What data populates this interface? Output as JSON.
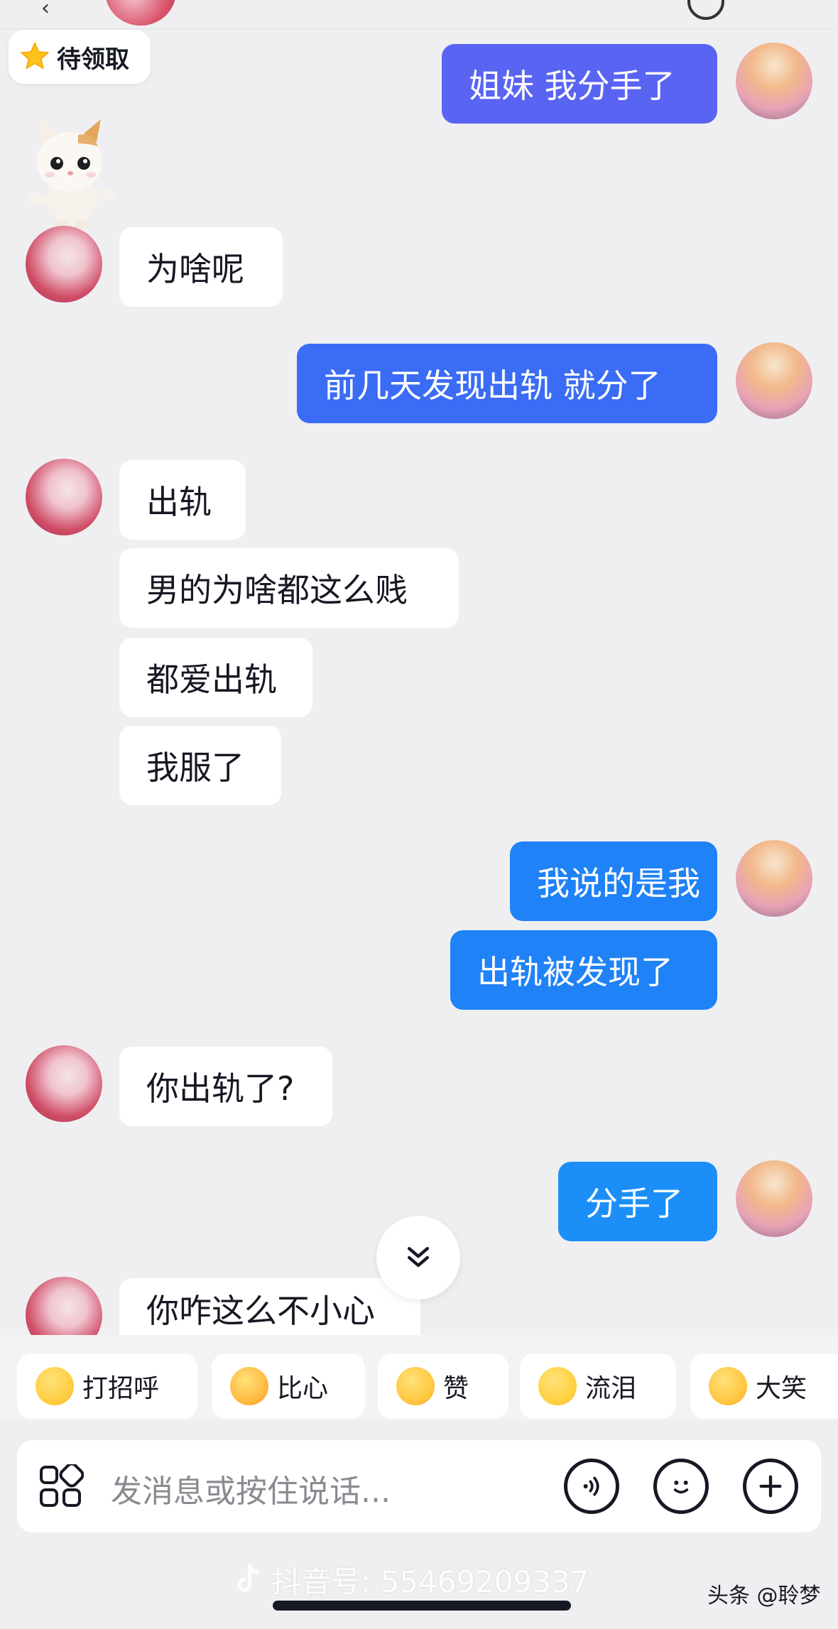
{
  "claim_badge": {
    "label": "待领取",
    "icon": "star-icon"
  },
  "conversation": [
    {
      "side": "right",
      "text": "姐妹 我分手了",
      "color": "#5a64f2",
      "group_start": true
    },
    {
      "side": "left",
      "text": "为啥呢",
      "group_start": true
    },
    {
      "side": "right",
      "text": "前几天发现出轨 就分了",
      "color": "#3a6cf5",
      "group_start": true
    },
    {
      "side": "left",
      "text": "出轨",
      "group_start": true
    },
    {
      "side": "left",
      "text": "男的为啥都这么贱",
      "group_start": false
    },
    {
      "side": "left",
      "text": "都爱出轨",
      "group_start": false
    },
    {
      "side": "left",
      "text": "我服了",
      "group_start": false
    },
    {
      "side": "right",
      "text": "我说的是我",
      "color": "#1f82f6",
      "group_start": true
    },
    {
      "side": "right",
      "text": "出轨被发现了",
      "color": "#1f82f6",
      "group_start": false
    },
    {
      "side": "left",
      "text": "你出轨了?",
      "group_start": true
    },
    {
      "side": "right",
      "text": "分手了",
      "color": "#1b8ff7",
      "group_start": true
    },
    {
      "side": "left",
      "text": "你咋这么不小心",
      "group_start": true
    }
  ],
  "quick_replies": [
    {
      "label": "打招呼",
      "icon": "wave-emoji-icon"
    },
    {
      "label": "比心",
      "icon": "finger-heart-emoji-icon"
    },
    {
      "label": "赞",
      "icon": "thumbs-up-emoji-icon"
    },
    {
      "label": "流泪",
      "icon": "crying-emoji-icon"
    },
    {
      "label": "大笑",
      "icon": "laughing-emoji-icon"
    }
  ],
  "input": {
    "placeholder": "发消息或按住说话..."
  },
  "watermark": {
    "text": "抖音号: 55469209337"
  },
  "corner_mark": {
    "text": "头条 @聆梦"
  },
  "colors": {
    "background": "#efeff2",
    "bubble_left": "#ffffff",
    "text": "#161823"
  }
}
